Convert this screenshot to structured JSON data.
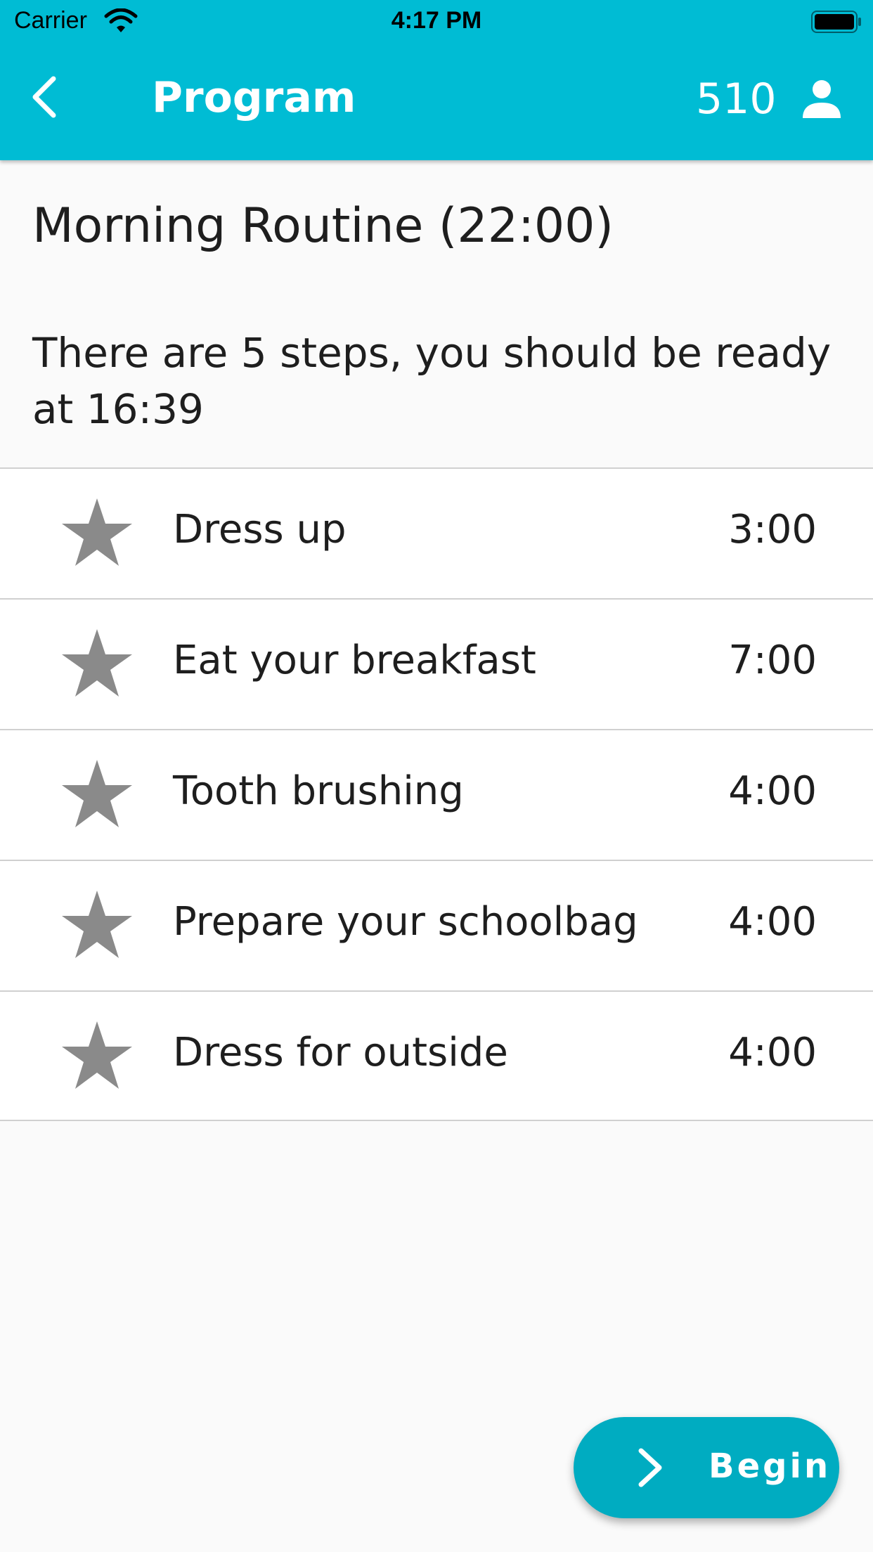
{
  "status_bar": {
    "carrier": "Carrier",
    "time": "4:17 PM"
  },
  "nav": {
    "title": "Program",
    "points": "510",
    "back_icon": "chevron-left-icon",
    "profile_icon": "person-icon"
  },
  "routine": {
    "title": "Morning Routine (22:00)",
    "info": "There are 5 steps, you should be ready at 16:39"
  },
  "steps": [
    {
      "icon": "star-icon",
      "name": "Dress up",
      "time": "3:00"
    },
    {
      "icon": "star-icon",
      "name": "Eat your breakfast",
      "time": "7:00"
    },
    {
      "icon": "star-icon",
      "name": "Tooth brushing",
      "time": "4:00"
    },
    {
      "icon": "star-icon",
      "name": "Prepare your schoolbag",
      "time": "4:00"
    },
    {
      "icon": "star-icon",
      "name": "Dress for outside",
      "time": "4:00"
    }
  ],
  "begin_button": {
    "label": "Begin",
    "icon": "chevron-right-icon"
  },
  "colors": {
    "header": "#00bcd4",
    "button": "#00acc1",
    "star": "#8a8a8a"
  }
}
